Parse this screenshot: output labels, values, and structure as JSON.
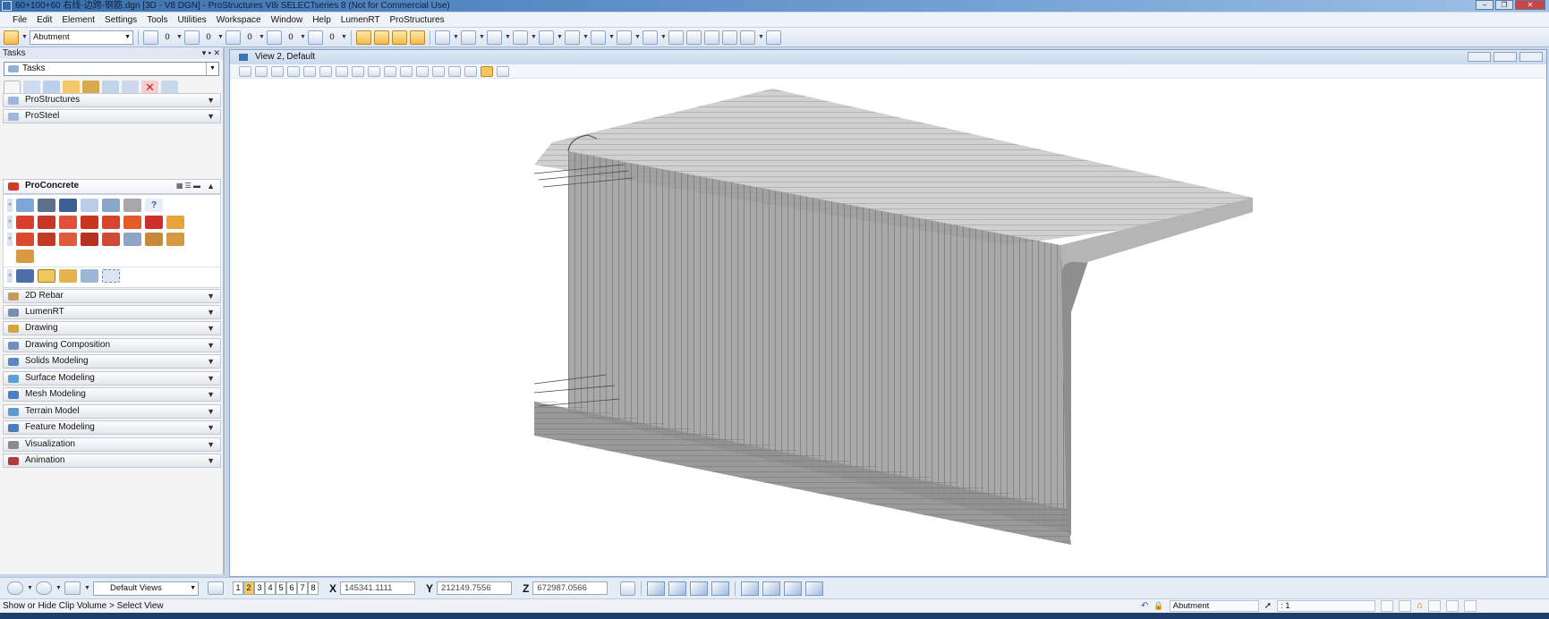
{
  "window": {
    "title": "60+100+60 右线-边跨-钢筋.dgn [3D - V8 DGN] - ProStructures V8i SELECTseries 8 (Not for Commercial Use)",
    "minimize": "–",
    "restore": "❐",
    "close": "✕"
  },
  "menu": [
    "File",
    "Edit",
    "Element",
    "Settings",
    "Tools",
    "Utilities",
    "Workspace",
    "Window",
    "Help",
    "LumenRT",
    "ProStructures"
  ],
  "toolbar": {
    "level_value": "Abutment",
    "color_value": "0",
    "style_value": "0",
    "weight_value": "0",
    "transparency_value": "0",
    "priority_value": "0"
  },
  "tasks": {
    "header": "Tasks",
    "dropdown_value": "Tasks",
    "sections": [
      {
        "label": "ProStructures",
        "icon_color": "#9db7d8",
        "expanded": false
      },
      {
        "label": "ProSteel",
        "icon_color": "#9db7d8",
        "expanded": false
      },
      {
        "label": "ProConcrete",
        "icon_color": "#d23a2a",
        "expanded": true
      },
      {
        "label": "2D Rebar",
        "icon_color": "#c79a5a",
        "expanded": false
      },
      {
        "label": "LumenRT",
        "icon_color": "#7a8fb0",
        "expanded": false
      },
      {
        "label": "Drawing",
        "icon_color": "#d4a73c",
        "expanded": false
      },
      {
        "label": "Drawing Composition",
        "icon_color": "#6f8fbf",
        "expanded": false
      },
      {
        "label": "Solids Modeling",
        "icon_color": "#5d86c4",
        "expanded": false
      },
      {
        "label": "Surface Modeling",
        "icon_color": "#5aa0d8",
        "expanded": false
      },
      {
        "label": "Mesh Modeling",
        "icon_color": "#4a7fc0",
        "expanded": false
      },
      {
        "label": "Terrain Model",
        "icon_color": "#5d9ad0",
        "expanded": false
      },
      {
        "label": "Feature Modeling",
        "icon_color": "#4b7bc2",
        "expanded": false
      },
      {
        "label": "Visualization",
        "icon_color": "#8b8b8b",
        "expanded": false
      },
      {
        "label": "Animation",
        "icon_color": "#b33b3b",
        "expanded": false
      }
    ]
  },
  "view": {
    "title": "View 2, Default"
  },
  "bottom": {
    "views_combo": "Default Views",
    "view_numbers": [
      "1",
      "2",
      "3",
      "4",
      "5",
      "6",
      "7",
      "8"
    ],
    "active_view": "2",
    "x_label": "X",
    "x_value": "145341.1111",
    "y_label": "Y",
    "y_value": "212149.7556",
    "z_label": "Z",
    "z_value": "672987.0566"
  },
  "status": {
    "prompt": "Show or Hide Clip Volume > Select View",
    "level": "Abutment",
    "selection_count": ": 1"
  },
  "colors": {
    "accent": "#3a6fae",
    "model_gray": "#9a9a9a"
  }
}
